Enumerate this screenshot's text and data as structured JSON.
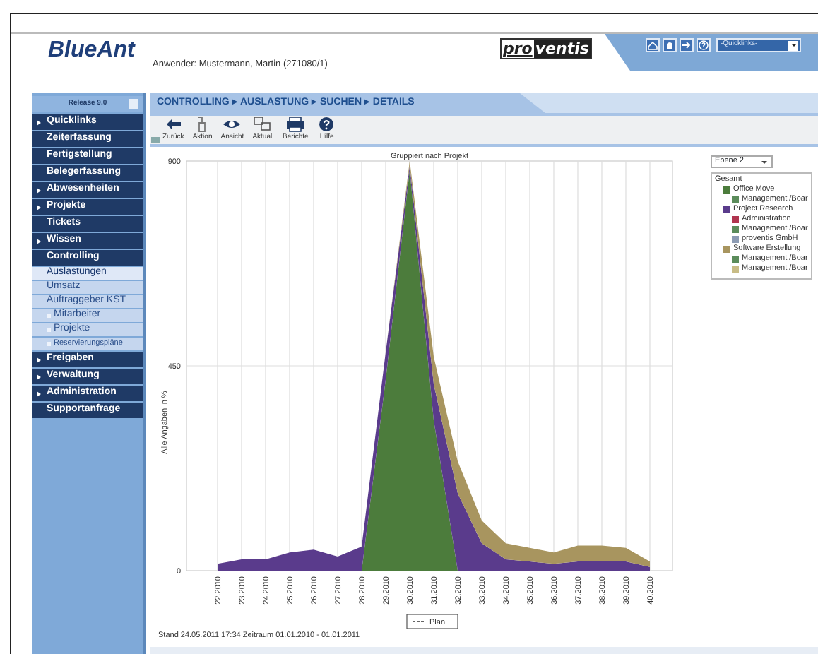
{
  "header": {
    "logo": "BlueAnt",
    "user": "Anwender: Mustermann, Martin (271080/1)",
    "brand_logo": {
      "part_1": "pro",
      "part_2": "ventis"
    },
    "quicklinks": {
      "value": "-Quicklinks-"
    }
  },
  "sidebar": {
    "release": "Release 9.0",
    "items": [
      {
        "label": "Quicklinks",
        "kind": "section",
        "expandable": true,
        "selected": false
      },
      {
        "label": "Zeiterfassung",
        "kind": "section",
        "expandable": false,
        "selected": false
      },
      {
        "label": "Fertigstellung",
        "kind": "section",
        "expandable": false,
        "selected": false
      },
      {
        "label": "Belegerfassung",
        "kind": "section",
        "expandable": false,
        "selected": false
      },
      {
        "label": "Abwesenheiten",
        "kind": "section",
        "expandable": true,
        "selected": false
      },
      {
        "label": "Projekte",
        "kind": "section",
        "expandable": true,
        "selected": false
      },
      {
        "label": "Tickets",
        "kind": "section",
        "expandable": false,
        "selected": false
      },
      {
        "label": "Wissen",
        "kind": "section",
        "expandable": true,
        "selected": false
      },
      {
        "label": "Controlling",
        "kind": "section",
        "expandable": false,
        "selected": false
      },
      {
        "label": "Auslastungen",
        "kind": "sub",
        "expandable": false,
        "selected": true
      },
      {
        "label": "Umsatz",
        "kind": "sub",
        "expandable": false,
        "selected": false
      },
      {
        "label": "Auftraggeber KST",
        "kind": "sub",
        "expandable": false,
        "selected": false,
        "children": [
          {
            "label": "Mitarbeiter",
            "kind": "leaf",
            "expandable": false,
            "selected": false
          },
          {
            "label": "Projekte",
            "kind": "leaf",
            "expandable": false,
            "selected": false
          },
          {
            "label": "Reservierungspläne",
            "kind": "leaf",
            "expandable": false,
            "selected": false
          }
        ]
      },
      {
        "label": "Freigaben",
        "kind": "section",
        "expandable": true,
        "selected": false
      },
      {
        "label": "Verwaltung",
        "kind": "section",
        "expandable": true,
        "selected": false
      },
      {
        "label": "Administration",
        "kind": "section",
        "expandable": true,
        "selected": false
      },
      {
        "label": "Supportanfrage",
        "kind": "section",
        "expandable": false,
        "selected": false
      }
    ]
  },
  "breadcrumb": "CONTROLLING ▸ AUSLASTUNG ▸ SUCHEN ▸ DETAILS",
  "toolbar": [
    {
      "label": "Zurück",
      "kind": "back"
    },
    {
      "label": "Aktion",
      "kind": "action"
    },
    {
      "label": "Ansicht",
      "kind": "view"
    },
    {
      "label": "Aktual.",
      "kind": "refresh"
    },
    {
      "label": "Berichte",
      "kind": "print"
    },
    {
      "label": "Hilfe",
      "kind": "help"
    }
  ],
  "chart": {
    "chart_data": {
      "type": "area",
      "title": "Gruppiert nach Projekt",
      "ylabel": "Alle Angaben in %",
      "stacked": true,
      "categories": [
        "22.2010",
        "23.2010",
        "24.2010",
        "25.2010",
        "26.2010",
        "27.2010",
        "28.2010",
        "29.2010",
        "30.2010",
        "31.2010",
        "32.2010",
        "33.2010",
        "34.2010",
        "35.2010",
        "36.2010",
        "37.2010",
        "38.2010",
        "39.2010",
        "40.2010"
      ],
      "ylim": [
        0,
        900
      ],
      "grid": true,
      "yticks": [
        0,
        450,
        900
      ],
      "series": [
        {
          "name": "Office Move",
          "color": "#4c7c3c",
          "values": [
            0,
            0,
            0,
            0,
            0,
            0,
            0,
            420,
            880,
            330,
            0,
            0,
            0,
            0,
            0,
            0,
            0,
            0,
            0
          ]
        },
        {
          "name": "Project Research",
          "color": "#5a3b8c",
          "values": [
            15,
            25,
            25,
            40,
            46,
            31,
            53,
            60,
            10,
            80,
            170,
            60,
            25,
            20,
            15,
            20,
            20,
            20,
            8
          ]
        },
        {
          "name": "Software Erstellung",
          "color": "#a8955f",
          "values": [
            0,
            0,
            0,
            0,
            0,
            0,
            0,
            0,
            10,
            60,
            70,
            50,
            35,
            30,
            25,
            35,
            35,
            30,
            12
          ]
        }
      ]
    },
    "legend": "Plan",
    "level_select": {
      "value": "Ebene 2"
    },
    "tree": [
      {
        "label": "Gesamt",
        "children": [
          {
            "kind": "series",
            "children": [
              {
                "label": "Management /Boar",
                "color": "#5b8c5b"
              }
            ]
          },
          {
            "kind": "series",
            "children": [
              {
                "label": "Administration",
                "color": "#b0354f"
              },
              {
                "label": "Management /Boar",
                "color": "#5b8c5b"
              },
              {
                "label": "proventis GmbH",
                "color": "#8c9bb3"
              }
            ]
          },
          {
            "kind": "series",
            "children": [
              {
                "label": "Management /Boar",
                "color": "#5b8c5b"
              },
              {
                "label": "Management /Boar",
                "color": "#c8bc86"
              }
            ]
          }
        ]
      }
    ]
  },
  "status_bar": "Stand 24.05.2011 17:34 Zeitraum 01.01.2010 - 01.01.2011"
}
